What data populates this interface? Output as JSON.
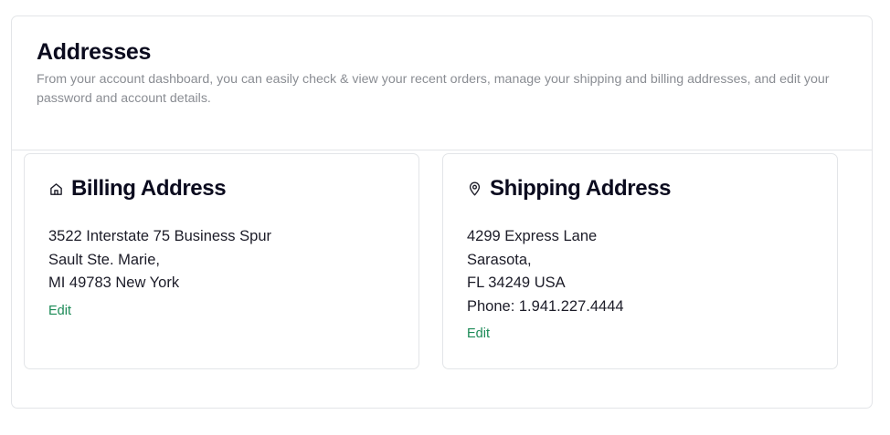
{
  "header": {
    "title": "Addresses",
    "description": "From your account dashboard, you can easily check & view your recent orders, manage your shipping and billing addresses, and edit your password and account details."
  },
  "billing": {
    "icon": "home-icon",
    "title": "Billing Address",
    "lines": [
      "3522 Interstate 75 Business Spur",
      "Sault Ste. Marie,",
      "MI 49783 New York"
    ],
    "edit_label": "Edit"
  },
  "shipping": {
    "icon": "map-pin-icon",
    "title": "Shipping Address",
    "lines": [
      "4299 Express Lane",
      "Sarasota,",
      "FL 34249 USA",
      "Phone: 1.941.227.4444"
    ],
    "edit_label": "Edit"
  },
  "colors": {
    "link": "#1b8a56",
    "border": "#e3e5e8",
    "muted_text": "#8a8d93"
  }
}
